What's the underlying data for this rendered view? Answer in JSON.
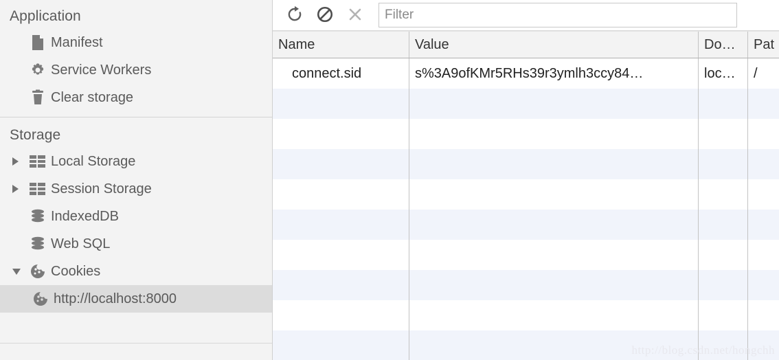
{
  "sidebar": {
    "sections": [
      {
        "title": "Application",
        "items": [
          {
            "label": "Manifest",
            "icon": "document-icon",
            "twisty": "none",
            "selected": false,
            "indent": 1
          },
          {
            "label": "Service Workers",
            "icon": "gear-icon",
            "twisty": "none",
            "selected": false,
            "indent": 1
          },
          {
            "label": "Clear storage",
            "icon": "trash-icon",
            "twisty": "none",
            "selected": false,
            "indent": 1
          }
        ]
      },
      {
        "title": "Storage",
        "items": [
          {
            "label": "Local Storage",
            "icon": "table-icon",
            "twisty": "collapsed",
            "selected": false,
            "indent": 1
          },
          {
            "label": "Session Storage",
            "icon": "table-icon",
            "twisty": "collapsed",
            "selected": false,
            "indent": 1
          },
          {
            "label": "IndexedDB",
            "icon": "database-icon",
            "twisty": "none",
            "selected": false,
            "indent": 1
          },
          {
            "label": "Web SQL",
            "icon": "database-icon",
            "twisty": "none",
            "selected": false,
            "indent": 1
          },
          {
            "label": "Cookies",
            "icon": "cookie-icon",
            "twisty": "expanded",
            "selected": false,
            "indent": 1
          },
          {
            "label": "http://localhost:8000",
            "icon": "cookie-icon",
            "twisty": "none",
            "selected": true,
            "indent": 2
          }
        ]
      }
    ]
  },
  "toolbar": {
    "refresh_label": "refresh-icon",
    "clear_label": "clear-all-icon",
    "close_label": "close-icon",
    "filter_placeholder": "Filter",
    "filter_value": ""
  },
  "table": {
    "columns": [
      {
        "key": "name",
        "label": "Name"
      },
      {
        "key": "value",
        "label": "Value"
      },
      {
        "key": "dom",
        "label": "Do…"
      },
      {
        "key": "path",
        "label": "Pat"
      }
    ],
    "rows": [
      {
        "name": "connect.sid",
        "value": "s%3A9ofKMr5RHs39r3ymlh3ccy84…",
        "dom": "loc…",
        "path": "/"
      }
    ],
    "empty_row_count": 9
  },
  "watermark": {
    "text": "http://blog.csdn.net/hongchh"
  },
  "colors": {
    "sidebar_bg": "#f3f3f3",
    "selected_bg": "#dcdcdc",
    "row_stripe": "#f1f4fb",
    "header_bg": "#f3f3f3",
    "text": "#5a5a5a"
  }
}
